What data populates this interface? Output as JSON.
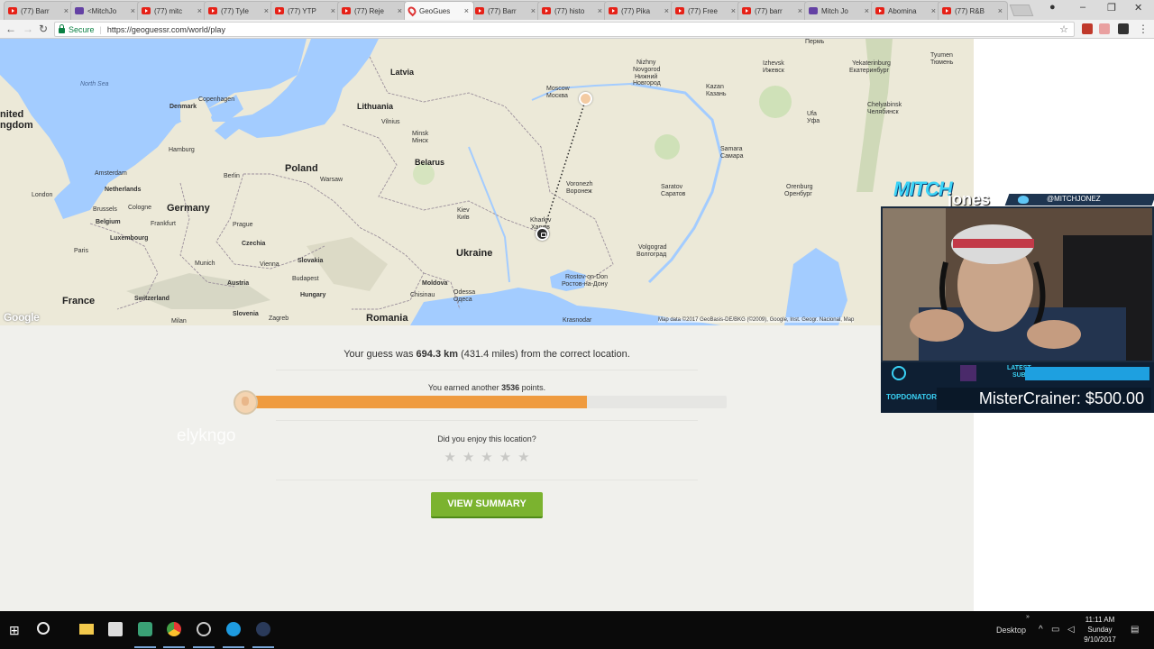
{
  "browser": {
    "tabs": [
      {
        "title": "(77) Barr",
        "icon": "youtube-icon"
      },
      {
        "title": "<MitchJo",
        "icon": "twitch-icon"
      },
      {
        "title": "(77) mitc",
        "icon": "youtube-icon"
      },
      {
        "title": "(77) Tyle",
        "icon": "youtube-icon"
      },
      {
        "title": "(77) YTP",
        "icon": "youtube-icon"
      },
      {
        "title": "(77) Reje",
        "icon": "youtube-icon"
      },
      {
        "title": "GeoGues",
        "icon": "geoguessr-pin-icon"
      },
      {
        "title": "(77) Barr",
        "icon": "youtube-icon"
      },
      {
        "title": "(77) histo",
        "icon": "youtube-icon"
      },
      {
        "title": "(77) Pika",
        "icon": "youtube-icon"
      },
      {
        "title": "(77) Free",
        "icon": "youtube-icon"
      },
      {
        "title": "(77) barr",
        "icon": "youtube-icon"
      },
      {
        "title": "Mitch Jo",
        "icon": "twitch-icon"
      },
      {
        "title": "Abomina",
        "icon": "youtube-icon"
      },
      {
        "title": "(77) R&B",
        "icon": "youtube-icon"
      }
    ],
    "active_tab_index": 6,
    "secure_label": "Secure",
    "url": "https://geoguessr.com/world/play"
  },
  "map": {
    "labels": {
      "north_sea": "North Sea",
      "united_kingdom_1": "nited",
      "united_kingdom_2": "ngdom",
      "denmark": "Denmark",
      "copenhagen": "Copenhagen",
      "latvia": "Latvia",
      "lithuania": "Lithuania",
      "vilnius": "Vilnius",
      "hamburg": "Hamburg",
      "berlin": "Berlin",
      "poland": "Poland",
      "warsaw": "Warsaw",
      "minsk": "Minsk",
      "minsk_ru": "Мінск",
      "belarus": "Belarus",
      "moscow": "Moscow",
      "moscow_ru": "Москва",
      "nizhny": "Nizhny",
      "novgorod": "Novgorod",
      "nizhny_ru": "Нижний",
      "novgorod_ru": "Новгород",
      "kazan": "Kazan",
      "kazan_ru": "Казань",
      "izhevsk": "Izhevsk",
      "izhevsk_ru": "Ижевск",
      "perm": "Пермь",
      "yekaterinburg": "Yekaterinburg",
      "yekaterinburg_ru": "Екатеринбург",
      "tyumen": "Tyumen",
      "tyumen_ru": "Тюмень",
      "chelyabinsk": "Chelyabinsk",
      "chelyabinsk_ru": "Челябинск",
      "ufa": "Ufa",
      "ufa_ru": "Уфа",
      "samara": "Samara",
      "samara_ru": "Самара",
      "orenburg": "Orenburg",
      "orenburg_ru": "Оренбург",
      "saratov": "Saratov",
      "saratov_ru": "Саратов",
      "voronezh": "Voronezh",
      "voronezh_ru": "Воронеж",
      "volgograd": "Volgograd",
      "volgograd_ru": "Волгоград",
      "rostov": "Rostov-on-Don",
      "rostov_ru": "Ростов-на-Дону",
      "krasnodar": "Krasnodar",
      "kharkiv": "Kharkiv",
      "kharkiv_ru": "Харків",
      "kyiv": "Kiev",
      "kyiv_ru": "Київ",
      "ukraine": "Ukraine",
      "moldova": "Moldova",
      "chisinau": "Chisinau",
      "odessa": "Odessa",
      "odessa_ru": "Одеса",
      "romania": "Romania",
      "amsterdam": "Amsterdam",
      "netherlands": "Netherlands",
      "london": "London",
      "brussels": "Brussels",
      "belgium": "Belgium",
      "cologne": "Cologne",
      "germany": "Germany",
      "frankfurt": "Frankfurt",
      "luxembourg": "Luxembourg",
      "prague": "Prague",
      "czechia": "Czechia",
      "munich": "Munich",
      "vienna": "Vienna",
      "slovakia": "Slovakia",
      "austria": "Austria",
      "budapest": "Budapest",
      "hungary": "Hungary",
      "paris": "Paris",
      "france": "France",
      "switzerland": "Switzerland",
      "slovenia": "Slovenia",
      "zagreb": "Zagreb",
      "milan": "Milan"
    },
    "google_logo": "Google",
    "attribution": "Map data ©2017 GeoBasis-DE/BKG (©2009), Google, Inst. Geogr. Nacional, Map",
    "colors": {
      "water": "#a3ccff",
      "land": "#ece9d8",
      "border": "#9b8f9b",
      "line": "#222222"
    }
  },
  "result": {
    "guess_prefix": "Your guess was ",
    "distance_km": "694.3 km",
    "distance_miles": " (431.4 miles) from the correct location.",
    "earned_prefix": "You earned another ",
    "points": "3536",
    "earned_suffix": " points.",
    "score_fraction": 0.709,
    "username": "elykngo",
    "enjoy_question": "Did you enjoy this location?",
    "star_glyph": "★",
    "rating_max": 5,
    "summary_button": "VIEW SUMMARY",
    "colors": {
      "progress": "#ef9b3f",
      "button": "#7bb32f"
    }
  },
  "stream_overlay": {
    "brand_first": "MITCH",
    "brand_second": "jones",
    "handle": "@MITCHJONEZ",
    "latest_label_top": "LATEST",
    "latest_label_bottom": "SUB",
    "top_label_prefix": "TOP",
    "top_label_suffix": "DONATOR",
    "top_donator": "MisterCrainer: $500.00",
    "colors": {
      "accent": "#3ad3f7",
      "panel": "#0e1f33"
    }
  },
  "taskbar": {
    "desktop_label": "Desktop",
    "time": "11:11 AM",
    "day": "Sunday",
    "date": "9/10/2017"
  }
}
